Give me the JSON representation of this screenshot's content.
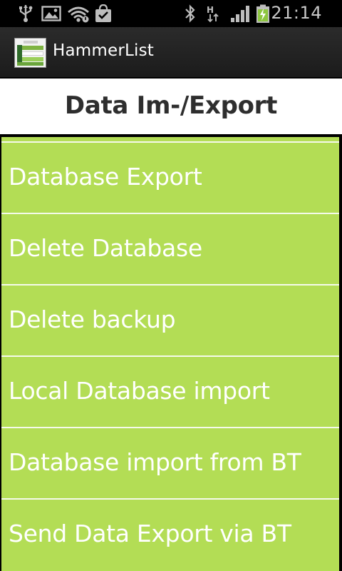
{
  "status_bar": {
    "time": "21:14",
    "icons": [
      "usb-icon",
      "image-icon",
      "wifi-icon",
      "bag-icon",
      "bluetooth-icon",
      "hspa-icon",
      "signal-icon",
      "battery-charging-icon"
    ]
  },
  "action_bar": {
    "app_title": "HammerList",
    "app_icon": "hammerlist-app-icon"
  },
  "page": {
    "heading": "Data Im-/Export"
  },
  "menu": {
    "items": [
      {
        "label": "Database Export"
      },
      {
        "label": "Delete Database"
      },
      {
        "label": "Delete backup"
      },
      {
        "label": "Local Database import"
      },
      {
        "label": "Database import from BT"
      },
      {
        "label": "Send Data Export via BT"
      }
    ]
  },
  "colors": {
    "list_background": "#b3dd55",
    "list_text": "#ffffff",
    "divider": "#f4faea",
    "heading_text": "#2e2e2e",
    "action_bar": "#222222"
  }
}
